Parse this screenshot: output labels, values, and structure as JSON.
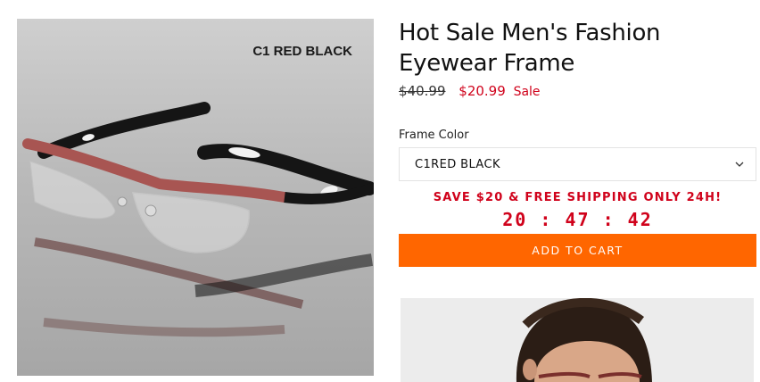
{
  "image": {
    "label": "C1 RED BLACK",
    "frame_color": "#a85552",
    "temple_color": "#151515"
  },
  "product": {
    "title": "Hot Sale Men's Fashion Eyewear Frame",
    "price_old": "$40.99",
    "price_new": "$20.99",
    "price_sale_label": "Sale"
  },
  "options": {
    "frame_color_label": "Frame Color",
    "frame_color_selected": "C1RED BLACK"
  },
  "promo": {
    "text": "SAVE $20 & FREE SHIPPING ONLY 24H!",
    "timer": "20 : 47 : 42"
  },
  "cart": {
    "add_label": "ADD TO CART"
  },
  "colors": {
    "accent": "#ff6600",
    "sale_red": "#d0021b"
  },
  "icons": {
    "select_arrow": "chevron-down-icon"
  }
}
